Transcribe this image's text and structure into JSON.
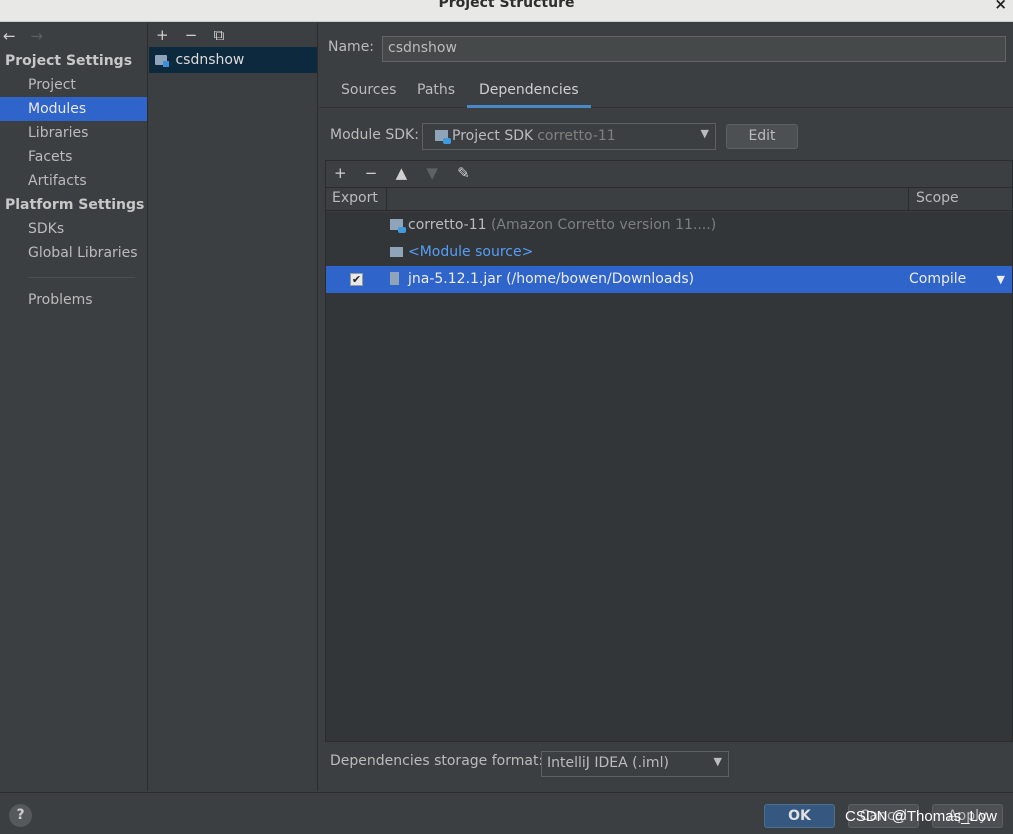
{
  "window": {
    "title": "Project Structure",
    "close_glyph": "×"
  },
  "nav": {
    "back_glyph": "←",
    "forward_glyph": "→",
    "section_project": "Project Settings",
    "project_items": [
      "Project",
      "Modules",
      "Libraries",
      "Facets",
      "Artifacts"
    ],
    "selected": "Modules",
    "section_platform": "Platform Settings",
    "platform_items": [
      "SDKs",
      "Global Libraries"
    ],
    "problems": "Problems"
  },
  "modules": {
    "toolbar": {
      "add": "+",
      "remove": "−",
      "copy": "⧉"
    },
    "items": [
      "csdnshow"
    ]
  },
  "module": {
    "name_label": "Name:",
    "name_value": "csdnshow",
    "tabs": [
      "Sources",
      "Paths",
      "Dependencies"
    ],
    "active_tab": "Dependencies",
    "sdk_label": "Module SDK:",
    "sdk_value": "Project SDK",
    "sdk_detail": "corretto-11",
    "edit_label": "Edit"
  },
  "dependencies": {
    "toolbar": {
      "add": "+",
      "remove": "−",
      "up": "▲",
      "down": "▼",
      "edit": "✎"
    },
    "columns": {
      "export": "Export",
      "scope": "Scope"
    },
    "rows": [
      {
        "name": "corretto-11",
        "detail": "(Amazon Corretto version 11....)",
        "icon": "sdk-folder-icon"
      },
      {
        "name": "<Module source>",
        "icon": "module-source-icon"
      },
      {
        "name": "jna-5.12.1.jar",
        "detail": "(/home/bowen/Downloads)",
        "icon": "jar-icon",
        "exported": "✔",
        "scope": "Compile",
        "selected": true
      }
    ],
    "storage_label": "Dependencies storage format:",
    "storage_value": "IntelliJ IDEA (.iml)"
  },
  "footer": {
    "help": "?",
    "ok": "OK",
    "cancel": "Cancel",
    "apply": "Apply",
    "watermark": "CSDN @Thomas_Low"
  },
  "colors": {
    "selection": "#2f65ca",
    "link": "#589df6",
    "tab_underline": "#4a88c7",
    "background": "#3c3f41"
  }
}
